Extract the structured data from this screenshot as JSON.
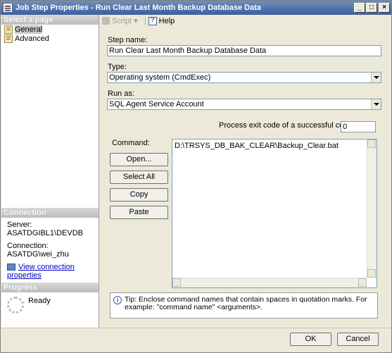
{
  "window": {
    "title": "Job Step Properties - Run Clear Last Month Backup Database Data",
    "min_glyph": "_",
    "max_glyph": "□",
    "close_glyph": "×"
  },
  "left": {
    "select_page_header": "Select a page",
    "pages": [
      {
        "label": "General",
        "icon": "page-icon",
        "selected": true
      },
      {
        "label": "Advanced",
        "icon": "page-icon",
        "selected": false
      }
    ],
    "connection_header": "Connection",
    "server_label": "Server:",
    "server_value": "ASATDGIBL1\\DEVDB",
    "connection_label": "Connection:",
    "connection_value": "ASATDG\\wei_zhu",
    "view_link": "View connection properties",
    "progress_header": "Progress",
    "progress_status": "Ready"
  },
  "toolbar": {
    "script_label": "Script",
    "script_dropdown": "▾",
    "help_label": "Help"
  },
  "form": {
    "step_name_label": "Step name:",
    "step_name_value": "Run Clear Last Month Backup Database Data",
    "type_label": "Type:",
    "type_value": "Operating system (CmdExec)",
    "run_as_label": "Run as:",
    "run_as_value": "SQL Agent Service Account",
    "exit_code_label": "Process exit code of a successful command:",
    "exit_code_value": "0",
    "command_label": "Command:",
    "command_value": "D:\\TRSYS_DB_BAK_CLEAR\\Backup_Clear.bat",
    "buttons": {
      "open": "Open...",
      "select_all": "Select All",
      "copy": "Copy",
      "paste": "Paste"
    },
    "tip_text": "Tip: Enclose command names that contain spaces in quotation marks. For example: \"command name\" <arguments>."
  },
  "footer": {
    "ok": "OK",
    "cancel": "Cancel"
  }
}
